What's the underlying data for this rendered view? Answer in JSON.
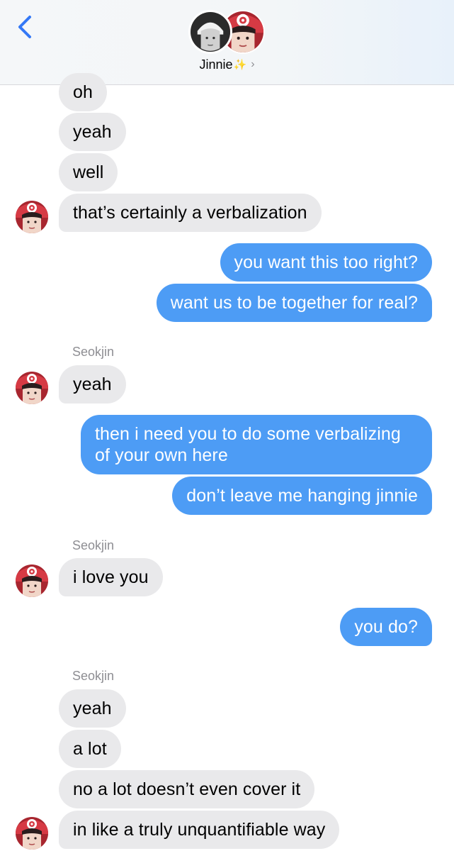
{
  "header": {
    "contact_name": "Jinnie",
    "sparkle": "✨",
    "chevron": "›",
    "back_icon": "chevron-left",
    "avatars": [
      "grayscale-photo",
      "red-hat-photo"
    ]
  },
  "colors": {
    "accent": "#3478f6",
    "outgoing_bubble": "#4d9cf5",
    "incoming_bubble": "#e9e9eb",
    "sender_label": "#8e8e93"
  },
  "messages": [
    {
      "dir": "in",
      "text": "oh"
    },
    {
      "dir": "in",
      "text": "yeah"
    },
    {
      "dir": "in",
      "text": "well"
    },
    {
      "dir": "in",
      "text": "that’s certainly a verbalization"
    },
    {
      "dir": "out",
      "text": "you want this too right?"
    },
    {
      "dir": "out",
      "text": "want us to be together for real?"
    },
    {
      "dir": "in",
      "sender": "Seokjin",
      "text": "yeah"
    },
    {
      "dir": "out",
      "text": "then i need you to do some verbalizing of your own here"
    },
    {
      "dir": "out",
      "text": "don’t leave me hanging jinnie"
    },
    {
      "dir": "in",
      "sender": "Seokjin",
      "text": "i love you"
    },
    {
      "dir": "out",
      "text": "you do?"
    },
    {
      "dir": "in",
      "sender": "Seokjin",
      "text": "yeah"
    },
    {
      "dir": "in",
      "text": "a lot"
    },
    {
      "dir": "in",
      "text": "no a lot doesn’t even cover it"
    },
    {
      "dir": "in",
      "text": "in like a truly unquantifiable way"
    }
  ]
}
